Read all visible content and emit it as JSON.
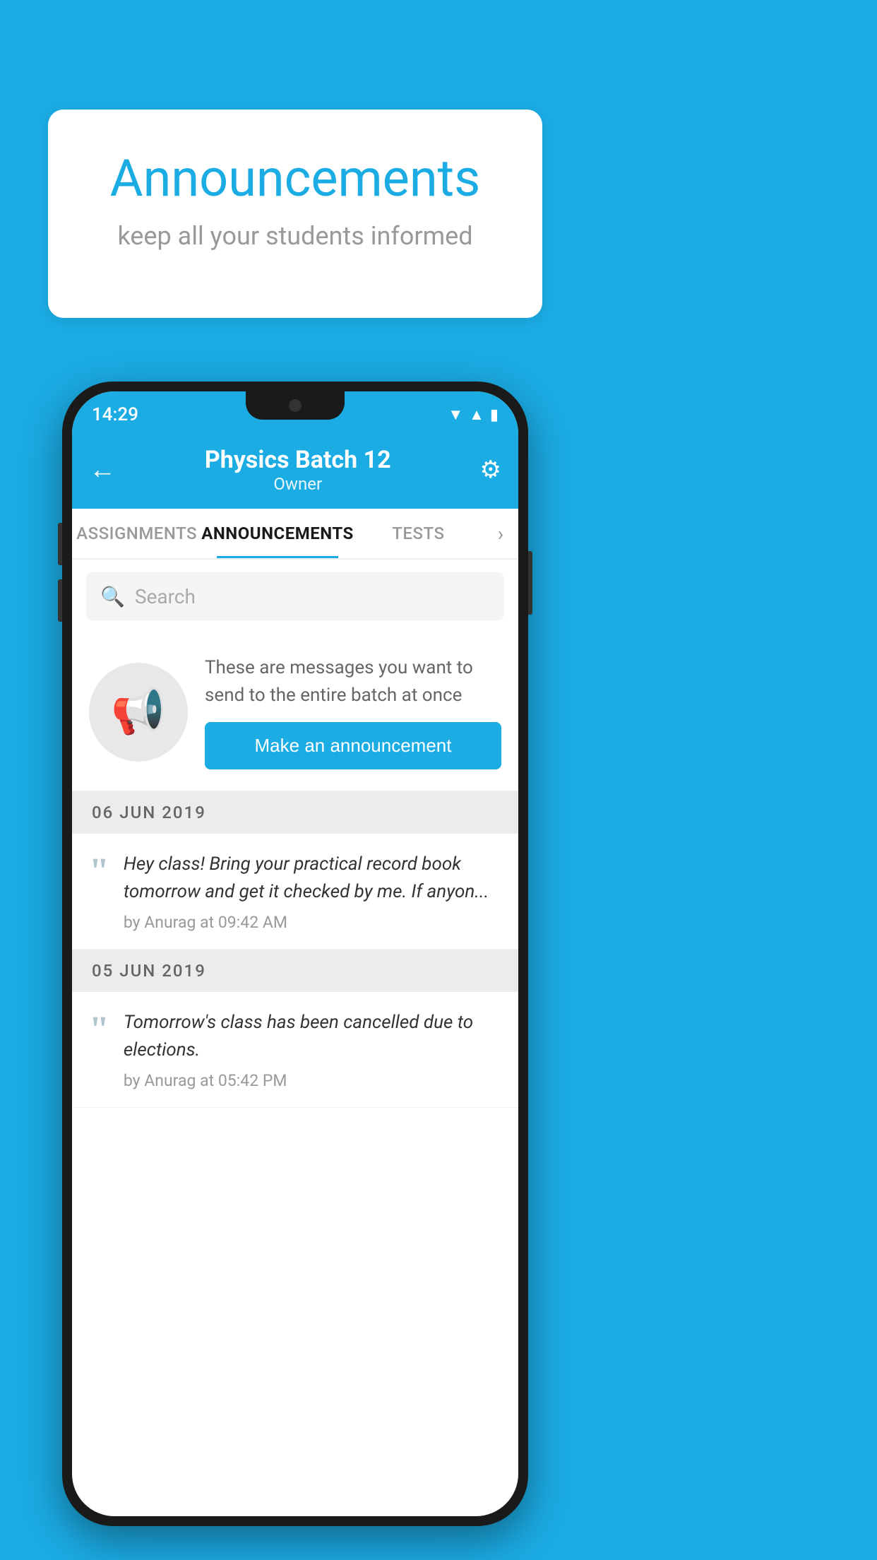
{
  "background_color": "#1BACE4",
  "speech_bubble": {
    "title": "Announcements",
    "subtitle": "keep all your students informed"
  },
  "phone": {
    "status_bar": {
      "time": "14:29",
      "icons": [
        "wifi",
        "signal",
        "battery"
      ]
    },
    "header": {
      "title": "Physics Batch 12",
      "subtitle": "Owner",
      "back_label": "←",
      "settings_label": "⚙"
    },
    "tabs": [
      {
        "label": "ASSIGNMENTS",
        "active": false
      },
      {
        "label": "ANNOUNCEMENTS",
        "active": true
      },
      {
        "label": "TESTS",
        "active": false
      }
    ],
    "search": {
      "placeholder": "Search"
    },
    "announcement_prompt": {
      "description": "These are messages you want to send to the entire batch at once",
      "button_label": "Make an announcement"
    },
    "announcements": [
      {
        "date": "06  JUN  2019",
        "text": "Hey class! Bring your practical record book tomorrow and get it checked by me. If anyon...",
        "meta": "by Anurag at 09:42 AM"
      },
      {
        "date": "05  JUN  2019",
        "text": "Tomorrow's class has been cancelled due to elections.",
        "meta": "by Anurag at 05:42 PM"
      }
    ]
  }
}
